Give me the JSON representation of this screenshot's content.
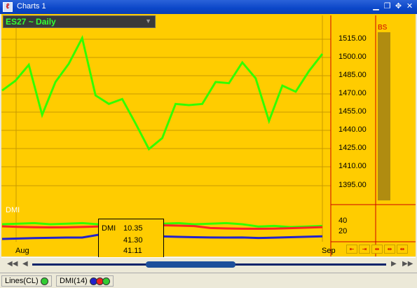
{
  "window": {
    "title": "Charts 1"
  },
  "title_buttons": [
    "minimize-icon",
    "restore-icon",
    "move-icon",
    "close-icon"
  ],
  "symbol": {
    "label": "ES27 ~ Daily"
  },
  "price_axis": {
    "ticks": [
      "1515.00",
      "1500.00",
      "1485.00",
      "1470.00",
      "1455.00",
      "1440.00",
      "1425.00",
      "1410.00",
      "1395.00"
    ]
  },
  "dmi": {
    "label": "DMI",
    "axis_ticks": [
      "40",
      "20"
    ],
    "popup": {
      "label": "DMI",
      "values": [
        "10.35",
        "41.30",
        "41.11"
      ]
    }
  },
  "bs": {
    "label": "BS"
  },
  "x_axis": {
    "labels": [
      "Aug",
      "Sep"
    ]
  },
  "nav_buttons": [
    "⇤",
    "⇥",
    "⇹",
    "⇹",
    "⇹"
  ],
  "status": {
    "lines_label": "Lines(CL)",
    "dmi_label": "DMI(14)"
  },
  "colors": {
    "plot_bg": "#FFCC00",
    "price_line": "#33FF00",
    "dmi_green": "#33FF00",
    "dmi_red": "#FF2222",
    "dmi_blue": "#2222CC"
  },
  "chart_data": {
    "type": "line",
    "series": [
      {
        "values": [
          1473,
          1481,
          1494,
          1453,
          1480,
          1495,
          1516,
          1469,
          1462,
          1466,
          1446,
          1425,
          1434,
          1462,
          1461,
          1462,
          1480,
          1479,
          1496,
          1483,
          1448,
          1477,
          1472,
          1489,
          1503
        ]
      }
    ],
    "ylim": [
      1385,
      1530
    ],
    "x_labels": [
      "Aug",
      "Sep"
    ]
  }
}
